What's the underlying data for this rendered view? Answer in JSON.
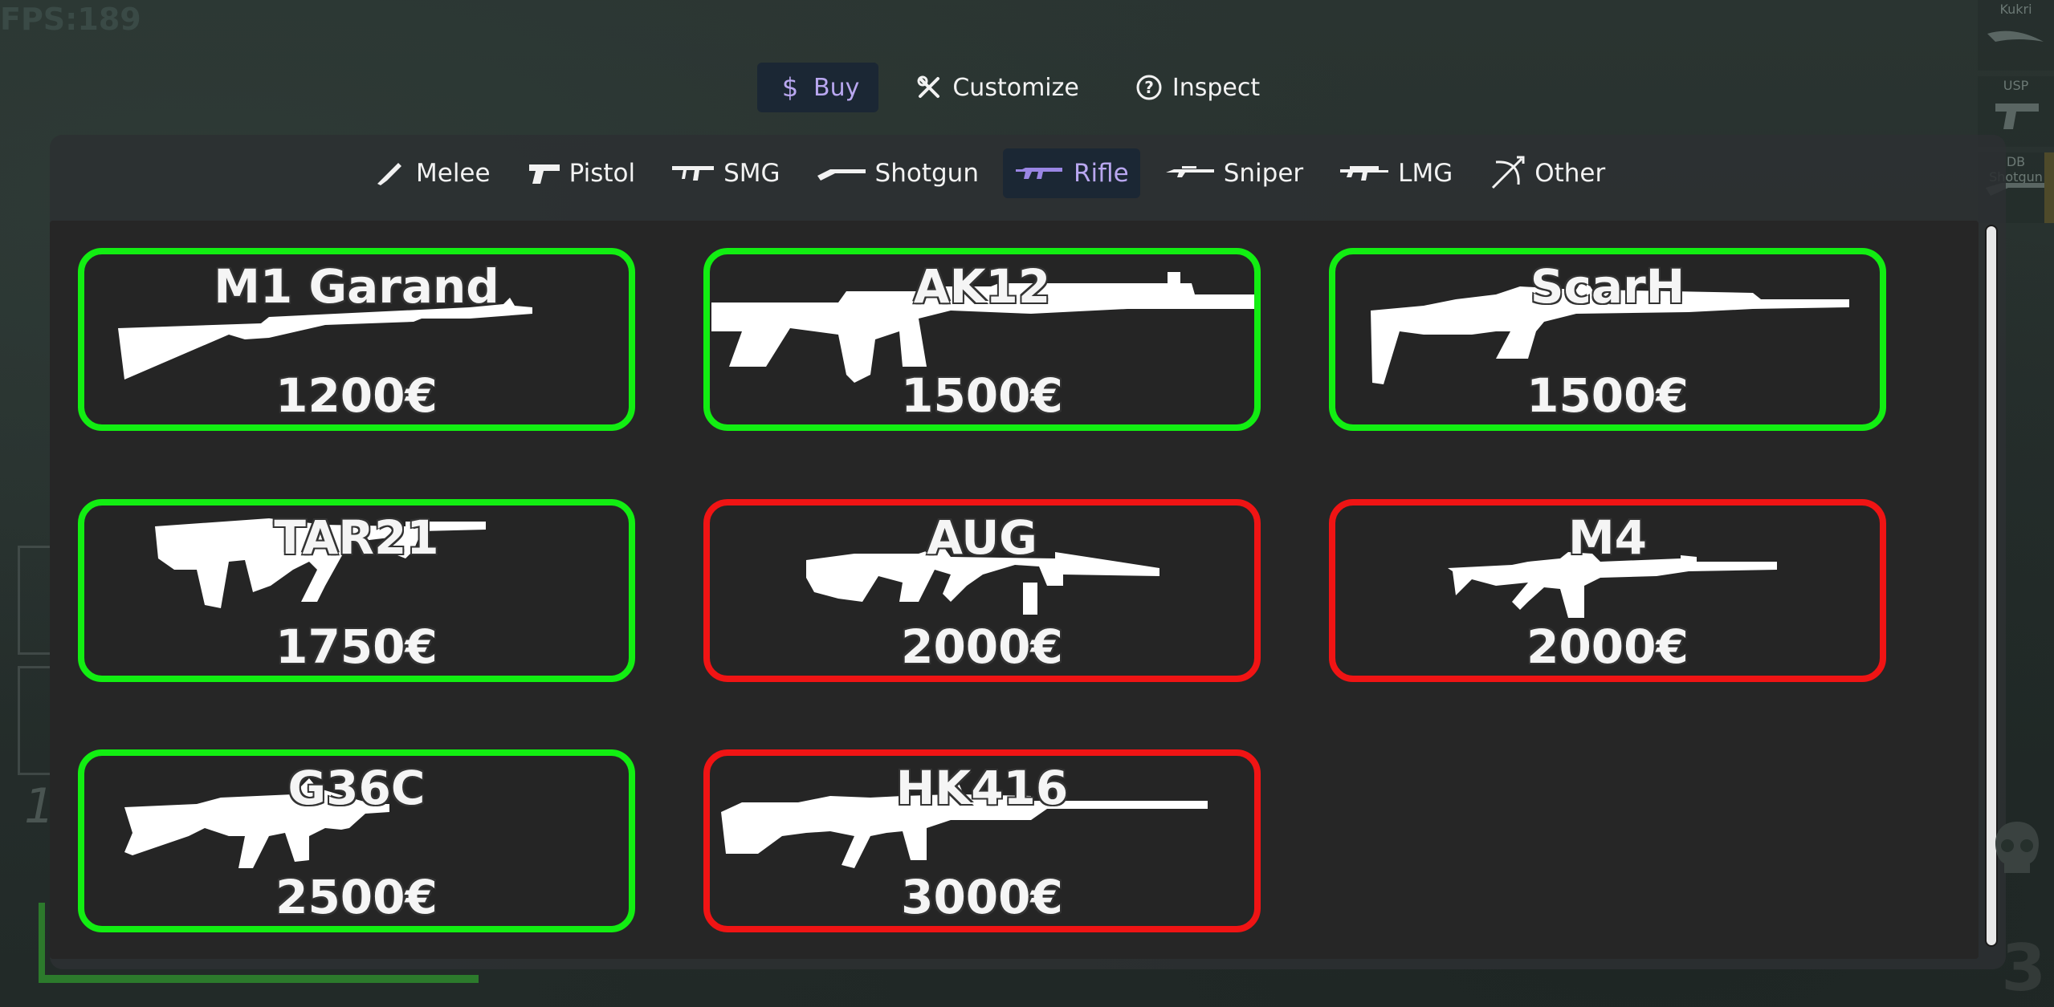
{
  "hud": {
    "fps": "FPS:189",
    "score_partial": "1",
    "kills_partial": "3"
  },
  "loadout": [
    {
      "name": "Kukri"
    },
    {
      "name": "USP"
    },
    {
      "name": "DB Shotgun"
    }
  ],
  "mode_tabs": [
    {
      "label": "Buy",
      "icon": "dollar-icon",
      "active": true
    },
    {
      "label": "Customize",
      "icon": "tools-icon",
      "active": false
    },
    {
      "label": "Inspect",
      "icon": "question-circle-icon",
      "active": false
    }
  ],
  "category_tabs": [
    {
      "label": "Melee",
      "icon": "knife-icon",
      "active": false
    },
    {
      "label": "Pistol",
      "icon": "pistol-icon",
      "active": false
    },
    {
      "label": "SMG",
      "icon": "smg-icon",
      "active": false
    },
    {
      "label": "Shotgun",
      "icon": "shotgun-icon",
      "active": false
    },
    {
      "label": "Rifle",
      "icon": "rifle-icon",
      "active": true
    },
    {
      "label": "Sniper",
      "icon": "sniper-icon",
      "active": false
    },
    {
      "label": "LMG",
      "icon": "lmg-icon",
      "active": false
    },
    {
      "label": "Other",
      "icon": "bow-icon",
      "active": false
    }
  ],
  "weapons": [
    {
      "name": "M1 Garand",
      "price": "1200€",
      "affordable": true
    },
    {
      "name": "AK12",
      "price": "1500€",
      "affordable": true
    },
    {
      "name": "ScarH",
      "price": "1500€",
      "affordable": true
    },
    {
      "name": "TAR21",
      "price": "1750€",
      "affordable": true
    },
    {
      "name": "AUG",
      "price": "2000€",
      "affordable": false
    },
    {
      "name": "M4",
      "price": "2000€",
      "affordable": false
    },
    {
      "name": "G36C",
      "price": "2500€",
      "affordable": false
    },
    {
      "name": "HK416",
      "price": "3000€",
      "affordable": false
    }
  ],
  "colors": {
    "affordable": "#12ee12",
    "unaffordable": "#f01414",
    "active_tab_bg": "#1b2734",
    "active_tab_text": "#b9a7f0"
  }
}
